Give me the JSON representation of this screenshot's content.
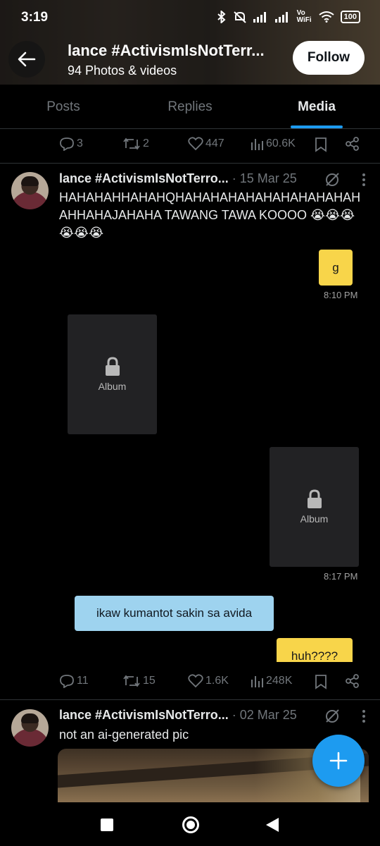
{
  "status": {
    "time": "3:19",
    "battery": "100",
    "vowifi": "Vo WiFi"
  },
  "header": {
    "title": "lance #ActivismIsNotTerr...",
    "subtitle": "94 Photos & videos",
    "follow_label": "Follow"
  },
  "tabs": [
    {
      "label": "Posts"
    },
    {
      "label": "Replies"
    },
    {
      "label": "Media",
      "active": true
    }
  ],
  "top_actions": {
    "replies": "3",
    "reposts": "2",
    "likes": "447",
    "views": "60.6K"
  },
  "posts": [
    {
      "name": "lance #ActivismIsNotTerro...",
      "date": "· 15 Mar 25",
      "text": "HAHAHAHHAHAHQHAHAHAHAHAHAHAHAHAHAHAHHAHAJAHAHA TAWANG TAWA KOOOO 😭😭😭😭😭😭",
      "chat": {
        "msg1": "g",
        "time1": "8:10 PM",
        "album_left": "Album",
        "album_right": "Album",
        "time2": "8:17 PM",
        "msg2": "ikaw kumantot sakin sa avida",
        "msg3": "huh????"
      },
      "actions": {
        "replies": "11",
        "reposts": "15",
        "likes": "1.6K",
        "views": "248K"
      }
    },
    {
      "name": "lance #ActivismIsNotTerro...",
      "date": "· 02 Mar 25",
      "text": "not an ai-generated pic"
    }
  ],
  "colors": {
    "accent": "#1d9bf0",
    "chat_yellow": "#f8d54a",
    "chat_blue": "#9ed3ef"
  }
}
